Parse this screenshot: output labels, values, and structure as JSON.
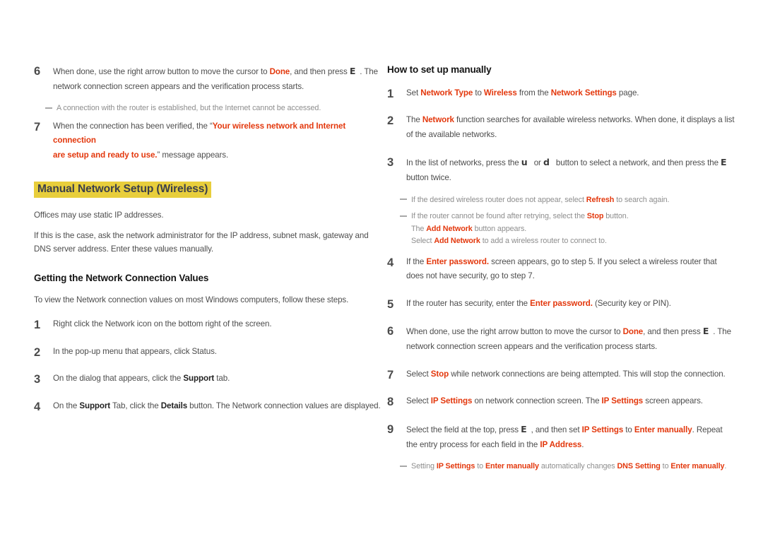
{
  "left_column": {
    "step6": {
      "num": "6",
      "line1_a": "When done, use the right arrow button to move the cursor to ",
      "line1_done": "Done",
      "line1_b": ", and then press ",
      "line1_key": "E",
      "line1_c": ". The",
      "line2": "network connection screen appears and the verification process starts."
    },
    "note_router": "A connection with the router is established, but the Internet cannot be accessed.",
    "step7": {
      "num": "7",
      "a": "When the connection has been verified, the ",
      "quote_open": "“",
      "msg_line1": "Your wireless network and Internet connection",
      "msg_line2": "are setup and ready to use.",
      "quote_close": "”",
      "b": " message appears."
    },
    "heading_manual": "Manual Network Setup (Wireless)",
    "para_offices": "Offices may use static IP addresses.",
    "para_static": "If this is the case, ask the network administrator for the IP address, subnet mask, gateway and DNS server address. Enter these values manually.",
    "heading_getting": "Getting the Network Connection Values",
    "para_toview": "To view the Network connection values on most Windows computers, follow these steps.",
    "steps": [
      {
        "num": "1",
        "parts": [
          {
            "t": "Right click the Network icon on the bottom right of the screen.",
            "s": "n"
          }
        ]
      },
      {
        "num": "2",
        "parts": [
          {
            "t": "In the pop-up menu that appears, click Status.",
            "s": "n"
          }
        ]
      },
      {
        "num": "3",
        "parts": [
          {
            "t": "On the dialog that appears, click the ",
            "s": "n"
          },
          {
            "t": "Support",
            "s": "b"
          },
          {
            "t": " tab.",
            "s": "n"
          }
        ]
      },
      {
        "num": "4",
        "parts": [
          {
            "t": "On the ",
            "s": "n"
          },
          {
            "t": "Support",
            "s": "b"
          },
          {
            "t": " Tab, click the ",
            "s": "n"
          },
          {
            "t": "Details",
            "s": "b"
          },
          {
            "t": " button. The Network connection values are displayed.",
            "s": "n"
          }
        ]
      }
    ]
  },
  "right_column": {
    "heading_howto": "How to set up manually",
    "step1": {
      "num": "1",
      "parts": [
        {
          "t": "Set ",
          "s": "n"
        },
        {
          "t": "Network Type",
          "s": "r"
        },
        {
          "t": " to ",
          "s": "n"
        },
        {
          "t": "Wireless",
          "s": "r"
        },
        {
          "t": " from the ",
          "s": "n"
        },
        {
          "t": "Network Settings",
          "s": "r"
        },
        {
          "t": " page.",
          "s": "n"
        }
      ]
    },
    "step2": {
      "num": "2",
      "parts": [
        {
          "t": "The ",
          "s": "n"
        },
        {
          "t": "Network",
          "s": "r"
        },
        {
          "t": " function searches for available wireless networks. When done, it displays a list of the available networks.",
          "s": "n"
        }
      ]
    },
    "step3": {
      "num": "3",
      "a": "In the list of networks, press the ",
      "key_up": "u",
      "b": " or ",
      "key_down": "d",
      "c": " button to select a network, and then press the ",
      "key_enter": "E",
      "d": " button twice."
    },
    "note_refresh": {
      "a": "If the desired wireless router does not appear, select ",
      "term": "Refresh",
      "b": " to search again."
    },
    "note_stop": {
      "a": "If the router cannot be found after retrying, select the ",
      "term": "Stop",
      "b": " button."
    },
    "note_add1": {
      "a": "The ",
      "term": "Add Network",
      "b": " button appears."
    },
    "note_add2": {
      "a": "Select ",
      "term": "Add Network",
      "b": " to add a wireless router to connect to."
    },
    "step4": {
      "num": "4",
      "parts": [
        {
          "t": "If the ",
          "s": "n"
        },
        {
          "t": "Enter password.",
          "s": "r"
        },
        {
          "t": " screen appears, go to step 5. If you select a wireless router that does not have security, go to step 7.",
          "s": "n"
        }
      ]
    },
    "step5": {
      "num": "5",
      "parts": [
        {
          "t": "If the router has security, enter the ",
          "s": "n"
        },
        {
          "t": "Enter password.",
          "s": "r"
        },
        {
          "t": " (Security key or PIN).",
          "s": "n"
        }
      ]
    },
    "step6": {
      "num": "6",
      "a": "When done, use the right arrow button to move the cursor to ",
      "done": "Done",
      "b": ", and then press ",
      "key_enter": "E",
      "c": ". The",
      "line2": "network connection screen appears and the verification process starts."
    },
    "step7": {
      "num": "7",
      "parts": [
        {
          "t": "Select ",
          "s": "n"
        },
        {
          "t": "Stop",
          "s": "r"
        },
        {
          "t": " while network connections are being attempted. This will stop the connection.",
          "s": "n"
        }
      ]
    },
    "step8": {
      "num": "8",
      "parts": [
        {
          "t": "Select ",
          "s": "n"
        },
        {
          "t": "IP Settings",
          "s": "r"
        },
        {
          "t": " on network connection screen. The ",
          "s": "n"
        },
        {
          "t": "IP Settings",
          "s": "r"
        },
        {
          "t": " screen appears.",
          "s": "n"
        }
      ]
    },
    "step9": {
      "num": "9",
      "a": "Select the field at the top, press ",
      "key_enter": "E",
      "b": ", and then set ",
      "term1": "IP Settings",
      "c": " to ",
      "term2": "Enter manually",
      "d": ". Repeat the entry process for each field in the ",
      "term3": "IP Address",
      "e": "."
    },
    "note_dns": {
      "a": "Setting ",
      "term1": "IP Settings",
      "b": " to ",
      "term2": "Enter manually",
      "c": " automatically changes ",
      "term3": "DNS Setting",
      "d": " to ",
      "term4": "Enter manually",
      "e": "."
    }
  },
  "colors": {
    "accent_red": "#e3380d",
    "highlight_yellow": "#e8ce3c",
    "heading_slate": "#3b3f4a",
    "body_gray": "#4d4d4d",
    "note_gray": "#8e8e8e"
  }
}
